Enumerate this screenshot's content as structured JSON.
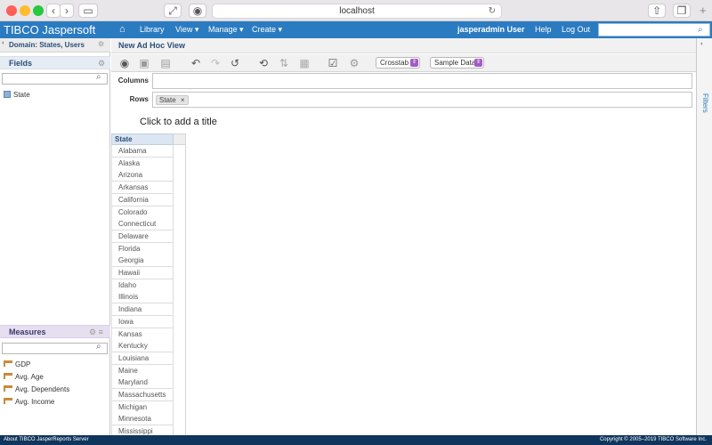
{
  "browser": {
    "url": "localhost",
    "colors": {
      "close": "#fe5f57",
      "minimize": "#febc2e",
      "zoom": "#28c840"
    }
  },
  "header": {
    "logo": "TIBCO Jaspersoft",
    "nav": [
      {
        "label": "Library"
      },
      {
        "label": "View ▾"
      },
      {
        "label": "Manage ▾"
      },
      {
        "label": "Create ▾"
      }
    ],
    "user": "jasperadmin User",
    "help": "Help",
    "logout": "Log Out",
    "search_value": ""
  },
  "left_panel": {
    "domain_title": "Domain: States, Users",
    "fields_label": "Fields",
    "fields_search": "",
    "fields": [
      {
        "label": "State",
        "icon": "dimension-icon"
      }
    ],
    "measures_label": "Measures",
    "measures_search": "",
    "measures": [
      {
        "label": "GDP",
        "icon": "measure-ruler-icon"
      },
      {
        "label": "Avg. Age",
        "icon": "measure-ruler-icon"
      },
      {
        "label": "Avg. Dependents",
        "icon": "measure-ruler-icon"
      },
      {
        "label": "Avg. Income",
        "icon": "measure-ruler-icon"
      }
    ]
  },
  "main": {
    "view_title": "New Ad Hoc View",
    "view_type": "Crosstab",
    "data_mode": "Sample Data",
    "columns_label": "Columns",
    "rows_label": "Rows",
    "rows_chip": "State",
    "chip_remove": "×",
    "add_title": "Click to add a title",
    "crosstab": {
      "header": "State",
      "rows": [
        "Alabama",
        "Alaska",
        "Arizona",
        "Arkansas",
        "California",
        "Colorado",
        "Connecticut",
        "Delaware",
        "Florida",
        "Georgia",
        "Hawaii",
        "Idaho",
        "Illinois",
        "Indiana",
        "Iowa",
        "Kansas",
        "Kentucky",
        "Louisiana",
        "Maine",
        "Maryland",
        "Massachusetts",
        "Michigan",
        "Minnesota",
        "Mississippi"
      ]
    }
  },
  "filters_label": "Filters",
  "footer": {
    "about": "About TIBCO JasperReports Server",
    "copyright": "Copyright © 2005–2019 TIBCO Software Inc."
  }
}
